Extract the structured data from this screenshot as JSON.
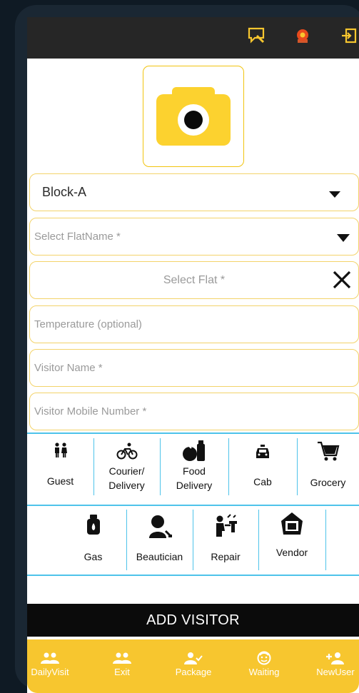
{
  "photo": {
    "icon": "camera-icon",
    "accent": "#fcd22f"
  },
  "form": {
    "block_value": "Block-A",
    "flatname_placeholder": "Select FlatName *",
    "flat_placeholder": "Select Flat *",
    "temperature_placeholder": "Temperature (optional)",
    "visitor_name_placeholder": "Visitor Name *",
    "visitor_mobile_placeholder": "Visitor Mobile Number *"
  },
  "categories_row1": [
    {
      "label": "Guest",
      "icon": "couple-icon"
    },
    {
      "label": "Courier/\nDelivery",
      "icon": "bicycle-icon"
    },
    {
      "label": "Food\nDelivery",
      "icon": "food-icon"
    },
    {
      "label": "Cab",
      "icon": "taxi-icon"
    },
    {
      "label": "Grocery",
      "icon": "cart-icon"
    }
  ],
  "categories_row2": [
    {
      "label": "Gas",
      "icon": "gas-cylinder-icon"
    },
    {
      "label": "Beautician",
      "icon": "beautician-icon"
    },
    {
      "label": "Repair",
      "icon": "repair-icon"
    },
    {
      "label": "Vendor",
      "icon": "shopping-bag-icon"
    }
  ],
  "add_button": "ADD VISITOR",
  "bottom_nav": [
    {
      "label": "DailyVisit",
      "icon": "group-icon"
    },
    {
      "label": "Exit",
      "icon": "group-icon"
    },
    {
      "label": "Package",
      "icon": "person-check-icon"
    },
    {
      "label": "Waiting",
      "icon": "face-icon"
    },
    {
      "label": "NewUser",
      "icon": "person-add-icon"
    }
  ],
  "colors": {
    "accent": "#f7c62f",
    "divider": "#4ec3ea",
    "topbar": "#262626"
  }
}
